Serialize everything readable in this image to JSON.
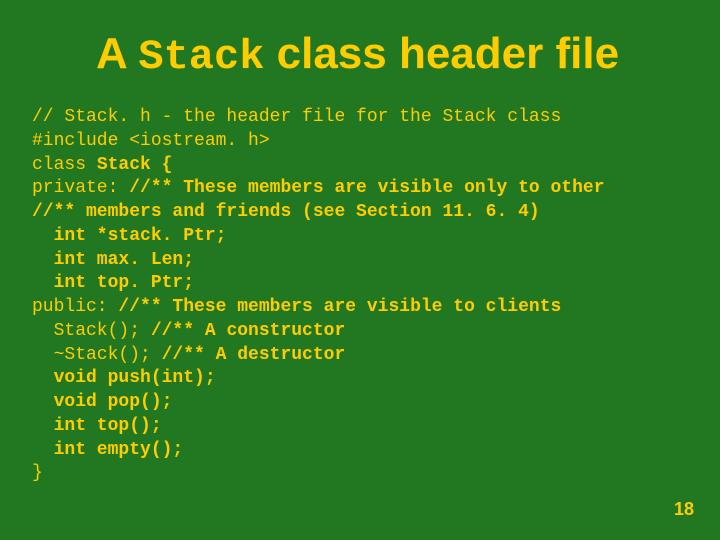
{
  "title": {
    "pre": "A ",
    "mono": "Stack",
    "post": " class header file"
  },
  "code": {
    "l1": "// Stack. h - the header file for the Stack class",
    "l2": "#include <iostream. h>",
    "l3a": "class ",
    "l3b": "Stack {",
    "l4a": "private: ",
    "l4b": "//** These members are visible only to other",
    "l5": "//** members and friends (see Section 11. 6. 4)",
    "l6": "  int *stack. Ptr;",
    "l7": "  int max. Len;",
    "l8": "  int top. Ptr;",
    "l9a": "public: ",
    "l9b": "//** These members are visible to clients",
    "l10a": "  Stack(); ",
    "l10b": "//** A constructor",
    "l11a": "  ~Stack(); ",
    "l11b": "//** A destructor",
    "l12": "  void push(int);",
    "l13": "  void pop();",
    "l14": "  int top();",
    "l15": "  int empty();",
    "l16": "}"
  },
  "page_number": "18"
}
